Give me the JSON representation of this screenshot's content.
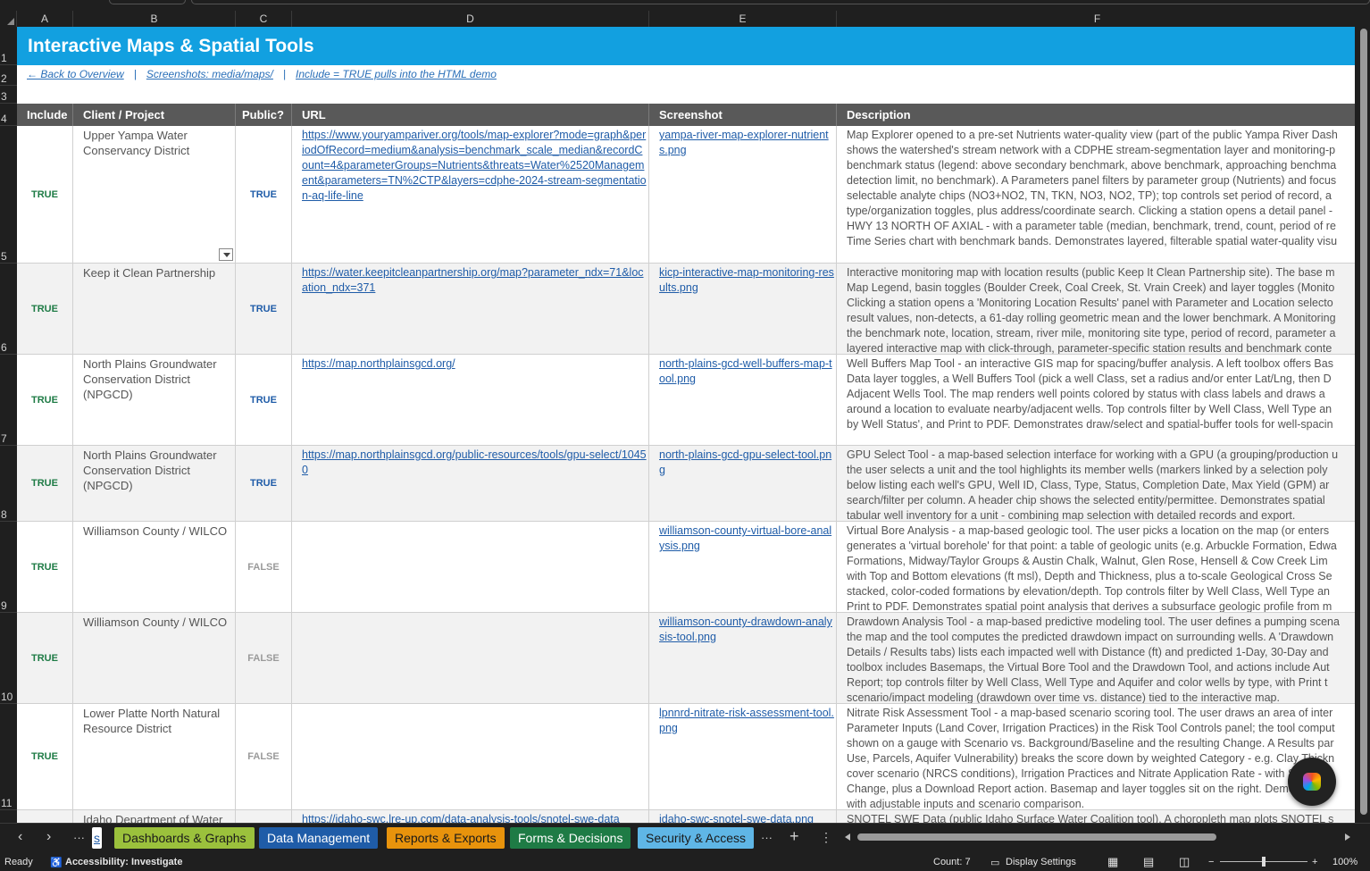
{
  "columns": [
    "A",
    "B",
    "C",
    "D",
    "E",
    "F"
  ],
  "row_numbers": [
    "1",
    "2",
    "3",
    "4",
    "5",
    "6",
    "7",
    "8",
    "9",
    "10",
    "11"
  ],
  "banner_title": "Interactive Maps & Spatial Tools",
  "nav": {
    "back": "← Back to Overview",
    "screenshots": "Screenshots: media/maps/",
    "include_note": "Include = TRUE pulls into the HTML demo",
    "separator": "|"
  },
  "table_headers": [
    "Include",
    "Client / Project",
    "Public?",
    "URL",
    "Screenshot",
    "Description"
  ],
  "rows": [
    {
      "include": "TRUE",
      "client": "Upper Yampa Water\nConservancy District",
      "public": "TRUE",
      "url": "https://www.youryampariver.org/tools/map-explorer?mode=graph&periodOfRecord=medium&analysis=benchmark_scale_median&recordCount=4&parameterGroups=Nutrients&threats=Water%2520Management&parameters=TN%2CTP&layers=cdphe-2024-stream-segmentation-aq-life-line",
      "screenshot": "yampa-river-map-explorer-nutrients.png",
      "description": [
        "Map Explorer opened to a pre-set Nutrients water-quality view (part of the public Yampa River Dash",
        "shows the watershed's stream network with a CDPHE stream-segmentation layer and monitoring-p",
        "benchmark status (legend: above secondary benchmark, above benchmark, approaching benchma",
        "detection limit, no benchmark). A Parameters panel filters by parameter group (Nutrients) and focus",
        "selectable analyte chips (NO3+NO2, TN, TKN, NO3, NO2, TP); top controls set period of record, a",
        "type/organization toggles, plus address/coordinate search. Clicking a station opens a detail panel -",
        "HWY 13 NORTH OF AXIAL - with a parameter table (median, benchmark, trend, count, period of re",
        "Time Series chart with benchmark bands. Demonstrates layered, filterable spatial water-quality visu"
      ]
    },
    {
      "include": "TRUE",
      "client": "Keep it Clean Partnership",
      "public": "TRUE",
      "url": "https://water.keepitcleanpartnership.org/map?parameter_ndx=71&location_ndx=371",
      "screenshot": "kicp-interactive-map-monitoring-results.png",
      "description": [
        "Interactive monitoring map with location results (public Keep It Clean Partnership site). The base m",
        "Map Legend, basin toggles (Boulder Creek, Coal Creek, St. Vrain Creek) and layer toggles (Monito",
        "Clicking a station opens a 'Monitoring Location Results' panel with Parameter and Location selecto",
        "result values, non-detects, a 61-day rolling geometric mean and the lower benchmark. A Monitoring",
        "the benchmark note, location, stream, river mile, monitoring site type, period of record, parameter a",
        "layered interactive map with click-through, parameter-specific station results and benchmark conte"
      ]
    },
    {
      "include": "TRUE",
      "client": "North Plains Groundwater\nConservation District\n(NPGCD)",
      "public": "TRUE",
      "url": "https://map.northplainsgcd.org/",
      "screenshot": "north-plains-gcd-well-buffers-map-tool.png",
      "description": [
        "Well Buffers Map Tool - an interactive GIS map for spacing/buffer analysis. A left toolbox offers Bas",
        "Data layer toggles, a Well Buffers Tool (pick a well Class, set a radius and/or enter Lat/Lng, then D",
        "Adjacent Wells Tool. The map renders well points colored by status with class labels and draws a",
        "around a location to evaluate nearby/adjacent wells. Top controls filter by Well Class, Well Type an",
        "by Well Status', and Print to PDF. Demonstrates draw/select and spatial-buffer tools for well-spacin"
      ]
    },
    {
      "include": "TRUE",
      "client": "North Plains Groundwater\nConservation District\n(NPGCD)",
      "public": "TRUE",
      "url": "https://map.northplainsgcd.org/public-resources/tools/gpu-select/10450",
      "screenshot": "north-plains-gcd-gpu-select-tool.png",
      "description": [
        "GPU Select Tool - a map-based selection interface for working with a GPU (a grouping/production u",
        "the user selects a unit and the tool highlights its member wells (markers linked by a selection poly",
        "below listing each well's GPU, Well ID, Class, Type, Status, Completion Date, Max Yield (GPM) ar",
        "search/filter per column. A header chip shows the selected entity/permittee. Demonstrates spatial",
        "tabular well inventory for a unit - combining map selection with detailed records and export."
      ]
    },
    {
      "include": "TRUE",
      "client": "Williamson County / WILCO",
      "public": "FALSE",
      "url": "",
      "screenshot": "williamson-county-virtual-bore-analysis.png",
      "description": [
        "Virtual Bore Analysis - a map-based geologic tool. The user picks a location on the map (or enters",
        "generates a 'virtual borehole' for that point: a table of geologic units (e.g. Arbuckle Formation, Edwa",
        "Formations, Midway/Taylor Groups & Austin Chalk, Walnut, Glen Rose, Hensell & Cow Creek Lim",
        "with Top and Bottom elevations (ft msl), Depth and Thickness, plus a to-scale Geological Cross Se",
        "stacked, color-coded formations by elevation/depth. Top controls filter by Well Class, Well Type an",
        "Print to PDF. Demonstrates spatial point analysis that derives a subsurface geologic profile from m"
      ]
    },
    {
      "include": "TRUE",
      "client": "Williamson County / WILCO",
      "public": "FALSE",
      "url": "",
      "screenshot": "williamson-county-drawdown-analysis-tool.png",
      "description": [
        "Drawdown Analysis Tool - a map-based predictive modeling tool. The user defines a pumping scena",
        "the map and the tool computes the predicted drawdown impact on surrounding wells. A 'Drawdown",
        "Details / Results tabs) lists each impacted well with Distance (ft) and predicted 1-Day, 30-Day and",
        "toolbox includes Basemaps, the Virtual Bore Tool and the Drawdown Tool, and actions include Aut",
        "Report; top controls filter by Well Class, Well Type and Aquifer and color wells by type, with Print t",
        "scenario/impact modeling (drawdown over time vs. distance) tied to the interactive map."
      ]
    },
    {
      "include": "TRUE",
      "client": "Lower Platte North Natural\nResource District",
      "public": "FALSE",
      "url": "",
      "screenshot": "lpnnrd-nitrate-risk-assessment-tool.png",
      "description": [
        "Nitrate Risk Assessment Tool - a map-based scenario scoring tool. The user draws an area of inter",
        "Parameter Inputs (Land Cover, Irrigation Practices) in the Risk Tool Controls panel; the tool comput",
        "shown on a gauge with Scenario vs. Background/Baseline and the resulting Change. A Results par",
        "Use, Parcels, Aquifer Vulnerability) breaks the score down by weighted Category - e.g. Clay Thickn",
        "cover scenario (NRCS conditions), Irrigation Practices and Nitrate Application Rate - with Scenario",
        "Change, plus a Download Report action. Basemap and layer toggles sit on the right. Demonstrates",
        "with adjustable inputs and scenario comparison."
      ]
    },
    {
      "include": "",
      "client": "Idaho Department of Water",
      "public": "",
      "url": "https://idaho-swc.lre-up.com/data-analysis-tools/snotel-swe-data",
      "screenshot": "idaho-swc-snotel-swe-data.png",
      "description": [
        "SNOTEL SWE Data (public Idaho Surface Water Coalition tool). A choropleth map plots SNOTEL s"
      ]
    }
  ],
  "sheet_tabs": [
    {
      "label": "s",
      "bg": "#ffffff",
      "fg": "#1f5ca8"
    },
    {
      "label": "Dashboards & Graphs",
      "bg": "#9bc13c",
      "fg": "#1a1a1a"
    },
    {
      "label": "Data Management",
      "bg": "#1f5ca8",
      "fg": "#ffffff"
    },
    {
      "label": "Reports & Exports",
      "bg": "#e8930c",
      "fg": "#1a1a1a"
    },
    {
      "label": "Forms & Decisions",
      "bg": "#1e7b45",
      "fg": "#ffffff"
    },
    {
      "label": "Security & Access",
      "bg": "#5fb6e6",
      "fg": "#1a1a1a"
    }
  ],
  "tab_controls": {
    "more": "···",
    "add": "+",
    "options": "⋮",
    "prev": "‹",
    "next": "›"
  },
  "status_bar": {
    "ready": "Ready",
    "accessibility": "Accessibility: Investigate",
    "count": "Count: 7",
    "display_settings": "Display Settings",
    "zoom": "100%",
    "zoom_minus": "−",
    "zoom_plus": "+"
  },
  "colors": {
    "banner": "#12a0e0",
    "header_bg": "#595959",
    "true_include": "#1e7b45",
    "true_public": "#1f5ca8",
    "false": "#9a9a9a"
  }
}
